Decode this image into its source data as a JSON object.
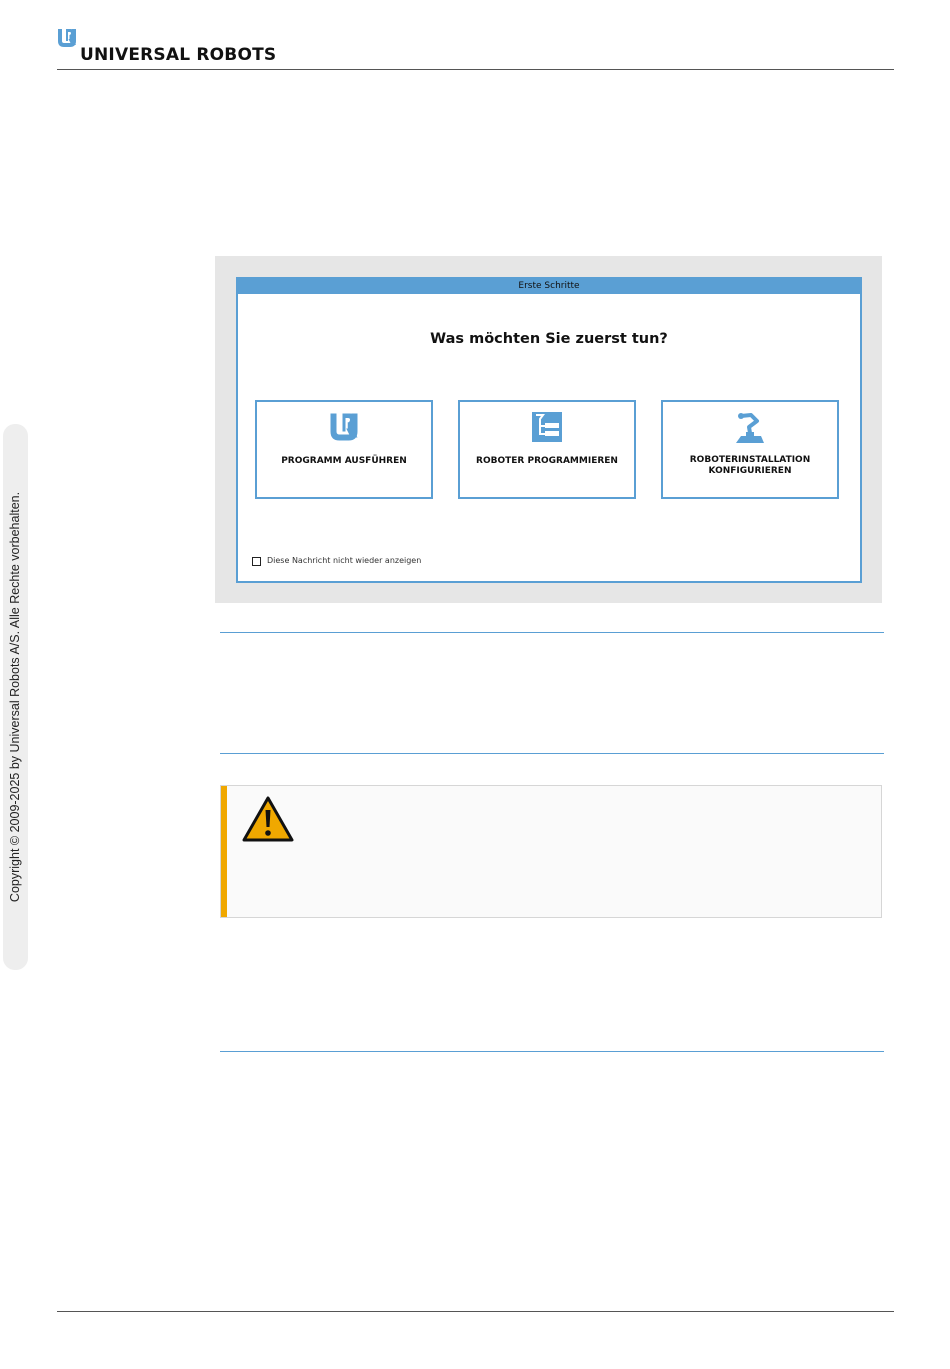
{
  "header": {
    "brand_name": "UNIVERSAL ROBOTS",
    "logo_icon": "ur-logo-icon"
  },
  "sidebar": {
    "copyright": "Copyright © 2009-2025 by Universal Robots A/S. Alle Rechte vorbehalten."
  },
  "screenshot": {
    "dialog_title": "Erste Schritte",
    "question": "Was möchten Sie zuerst tun?",
    "options": [
      {
        "label": "PROGRAMM AUSFÜHREN",
        "icon": "ur-logo-icon"
      },
      {
        "label": "ROBOTER PROGRAMMIEREN",
        "icon": "program-tree-icon"
      },
      {
        "label": "ROBOTERINSTALLATION KONFIGURIEREN",
        "icon": "robot-arm-icon"
      }
    ],
    "checkbox_label": "Diese Nachricht nicht wieder anzeigen",
    "checkbox_checked": false
  },
  "warning": {
    "icon": "warning-triangle-icon",
    "accent_color": "#f0a800"
  },
  "colors": {
    "accent_blue": "#5a9fd4",
    "warning_orange": "#f0a800"
  }
}
